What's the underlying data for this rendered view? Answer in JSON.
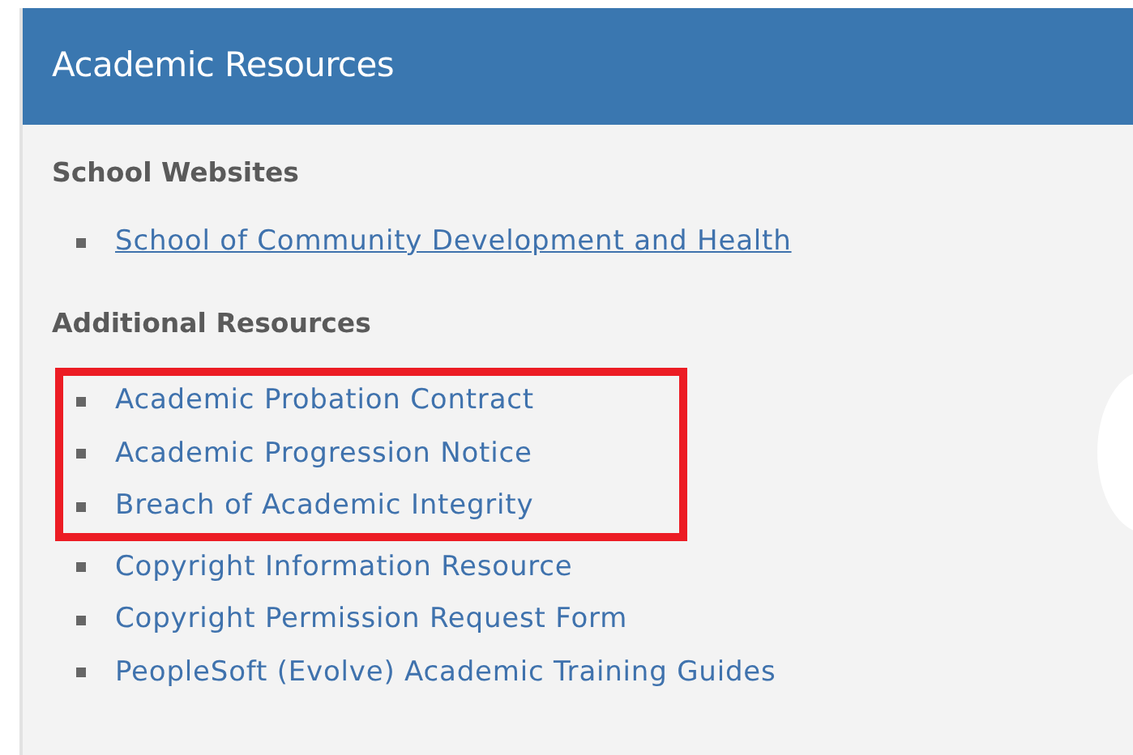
{
  "panel": {
    "title": "Academic Resources"
  },
  "sections": [
    {
      "heading": "School Websites",
      "links": [
        {
          "label": "School of Community Development and Health",
          "underlined": true,
          "highlighted": false
        }
      ]
    },
    {
      "heading": "Additional Resources",
      "links": [
        {
          "label": "Academic Probation Contract",
          "underlined": false,
          "highlighted": true
        },
        {
          "label": "Academic Progression Notice",
          "underlined": false,
          "highlighted": true
        },
        {
          "label": "Breach of Academic Integrity",
          "underlined": false,
          "highlighted": true
        },
        {
          "label": "Copyright Information Resource",
          "underlined": false,
          "highlighted": false
        },
        {
          "label": "Copyright Permission Request Form",
          "underlined": false,
          "highlighted": false
        },
        {
          "label": "PeopleSoft (Evolve) Academic Training Guides",
          "underlined": false,
          "highlighted": false
        }
      ]
    }
  ]
}
